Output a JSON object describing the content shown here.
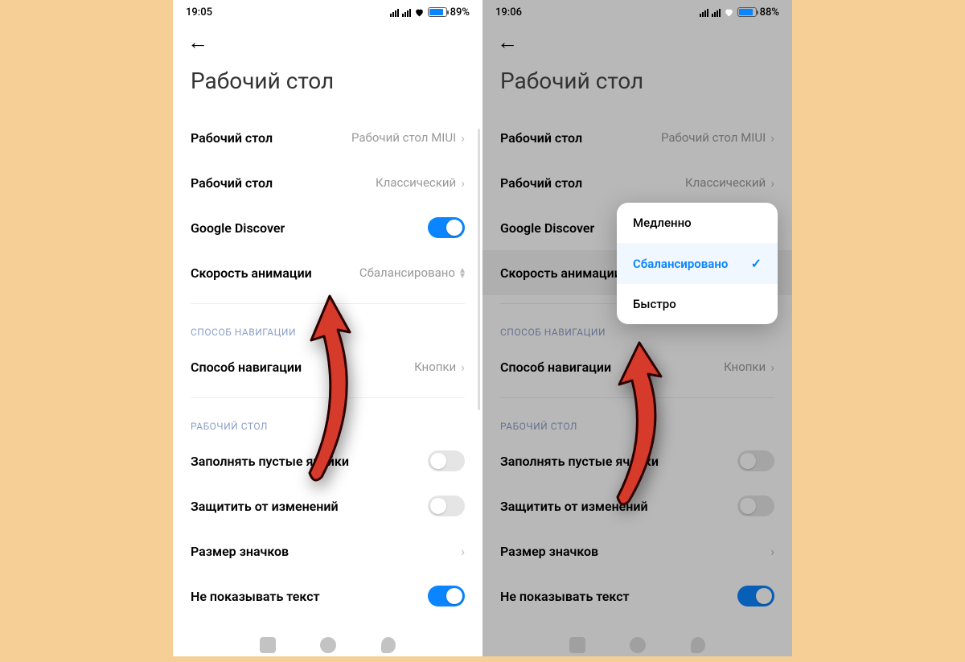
{
  "left": {
    "status": {
      "time": "19:05",
      "battery_pct": "89%"
    },
    "page_title": "Рабочий стол",
    "rows": {
      "launcher_label": "Рабочий стол",
      "launcher_value": "Рабочий стол MIUI",
      "style_label": "Рабочий стол",
      "style_value": "Классический",
      "discover_label": "Google Discover",
      "anim_label": "Скорость анимации",
      "anim_value": "Сбалансировано",
      "nav_section": "СПОСОБ НАВИГАЦИИ",
      "nav_label": "Способ навигации",
      "nav_value": "Кнопки",
      "desk_section": "РАБОЧИЙ СТОЛ",
      "fill_label": "Заполнять пустые ячейки",
      "lock_label": "Защитить от изменений",
      "iconsize_label": "Размер значков",
      "hidetext_label": "Не показывать текст"
    }
  },
  "right": {
    "status": {
      "time": "19:06",
      "battery_pct": "88%"
    },
    "page_title": "Рабочий стол",
    "rows": {
      "launcher_label": "Рабочий стол",
      "launcher_value": "Рабочий стол MIUI",
      "style_label": "Рабочий стол",
      "style_value": "Классический",
      "discover_label": "Google Discover",
      "anim_label": "Скорость анимации",
      "nav_section": "СПОСОБ НАВИГАЦИИ",
      "nav_label": "Способ навигации",
      "nav_value": "Кнопки",
      "desk_section": "РАБОЧИЙ СТОЛ",
      "fill_label": "Заполнять пустые ячейки",
      "lock_label": "Защитить от изменений",
      "iconsize_label": "Размер значков",
      "hidetext_label": "Не показывать текст"
    },
    "popup": {
      "opt1": "Медленно",
      "opt2": "Сбалансировано",
      "opt3": "Быстро"
    }
  }
}
